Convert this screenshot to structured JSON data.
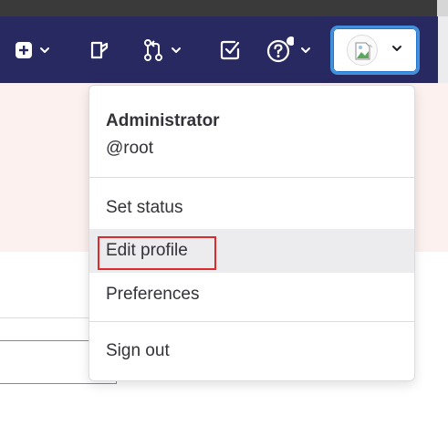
{
  "navbar": {
    "icons": [
      {
        "name": "plus-square-icon",
        "dropdown": true
      },
      {
        "name": "code-review-icon",
        "dropdown": false
      },
      {
        "name": "merge-request-icon",
        "dropdown": true
      },
      {
        "name": "todo-check-icon",
        "dropdown": false
      },
      {
        "name": "help-icon",
        "dropdown": true,
        "notification_dot": true
      }
    ],
    "user_button": {
      "avatar": "broken-image-avatar",
      "chevron": "chevron-down-icon"
    },
    "colors": {
      "background": "#292961",
      "focus_ring": "#428fdc"
    }
  },
  "user_menu": {
    "name": "Administrator",
    "username": "@root",
    "items": [
      {
        "label": "Set status"
      },
      {
        "label": "Edit profile",
        "hovered": true,
        "highlighted": true
      },
      {
        "label": "Preferences"
      },
      {
        "label": "Sign out"
      }
    ]
  },
  "colors": {
    "alert_bg": "#fcf1ef",
    "highlight": "#dd2b2b",
    "hover_bg": "#ececef"
  }
}
